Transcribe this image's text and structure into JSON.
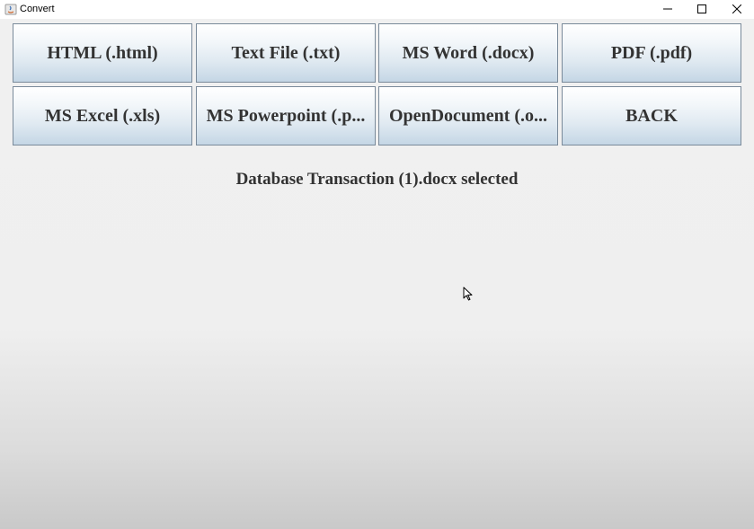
{
  "window": {
    "title": "Convert",
    "icons": {
      "app": "java-app-icon",
      "minimize": "minimize-icon",
      "maximize": "maximize-icon",
      "close": "close-icon"
    }
  },
  "buttons": {
    "row1": [
      "HTML (.html)",
      "Text File (.txt)",
      "MS Word (.docx)",
      "PDF (.pdf)"
    ],
    "row2": [
      "MS Excel (.xls)",
      "MS Powerpoint (.p...",
      "OpenDocument (.o...",
      "BACK"
    ]
  },
  "status": {
    "message": "Database Transaction (1).docx selected"
  },
  "colors": {
    "button_text": "#333333",
    "button_border": "#7a8a9a",
    "button_gradient_bottom": "#c4d6e5"
  }
}
